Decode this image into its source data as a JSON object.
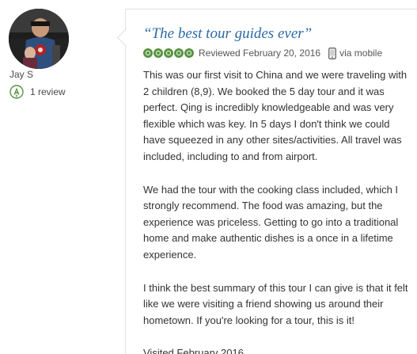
{
  "reviewer": {
    "name": "Jay S",
    "review_count": "1 review"
  },
  "review": {
    "title": "“The best tour guides ever”",
    "rating": 5,
    "rating_max": 5,
    "reviewed_date": "Reviewed February 20, 2016",
    "via": "via mobile",
    "paragraphs": [
      "This was our first visit to China and we were traveling with 2 children (8,9). We booked the 5 day tour and it was perfect. Qing is incredibly knowledgeable and was very flexible which was key. In 5 days I don't think we could have squeezed in any other sites/activities. All travel was included, including to and from airport.",
      "We had the tour with the cooking class included, which I strongly recommend. The food was amazing, but the experience was priceless. Getting to go into a traditional home and make authentic dishes is a once in a lifetime experience.",
      "I think the best summary of this tour I can give is that it felt like we were visiting a friend showing us around their hometown. If you're looking for a tour, this is it!"
    ],
    "visited": "Visited February 2016"
  },
  "colors": {
    "title": "#2b6aa6",
    "rating": "#589442",
    "badge": "#589442",
    "text": "#333333"
  },
  "icons": {
    "badge": "reviewer-badge-icon",
    "mobile": "mobile-phone-icon"
  }
}
